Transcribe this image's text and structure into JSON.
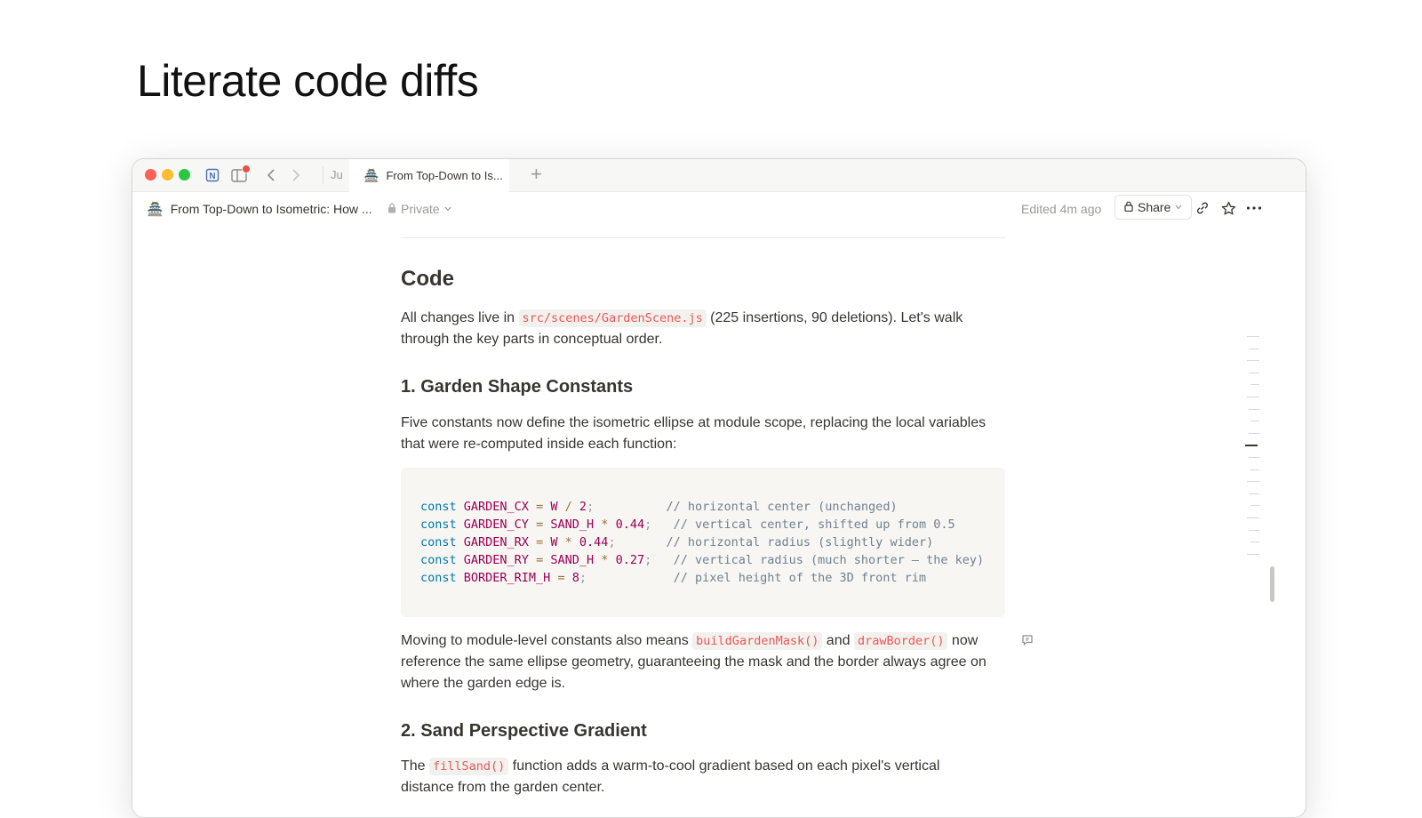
{
  "slide": {
    "title": "Literate code diffs"
  },
  "browser": {
    "tabs": [
      {
        "label": "Ju",
        "active": false
      },
      {
        "label": "From Top-Down to Is...",
        "emoji": "🏯",
        "active": true
      }
    ],
    "new_tab_label": "+",
    "notion_icon": "N"
  },
  "topbar": {
    "page_emoji": "🏯",
    "breadcrumb": "From Top-Down to Isometric: How ...",
    "privacy": "Private",
    "edited": "Edited 4m ago",
    "share_label": "Share",
    "icons": [
      "link-icon",
      "star-icon",
      "more-icon"
    ]
  },
  "doc": {
    "heading": "Code",
    "intro": {
      "before": "All changes live in ",
      "code": "src/scenes/GardenScene.js",
      "after": " (225 insertions, 90 deletions). Let's walk through the key parts in conceptual order."
    },
    "section1": {
      "title": "1. Garden Shape Constants",
      "desc": "Five constants now define the isometric ellipse at module scope, replacing the local variables that were re-computed inside each function:",
      "code_lines": [
        {
          "kw": "const",
          "name": "GARDEN_CX",
          "eq": "=",
          "expr1": "W",
          "op": "/",
          "expr2": "2",
          "semi": ";",
          "pad": "          ",
          "comment": "// horizontal center (unchanged)"
        },
        {
          "kw": "const",
          "name": "GARDEN_CY",
          "eq": "=",
          "expr1": "SAND_H",
          "op": "*",
          "expr2": "0.44",
          "semi": ";",
          "pad": "   ",
          "comment": "// vertical center, shifted up from 0.5"
        },
        {
          "kw": "const",
          "name": "GARDEN_RX",
          "eq": "=",
          "expr1": "W",
          "op": "*",
          "expr2": "0.44",
          "semi": ";",
          "pad": "       ",
          "comment": "// horizontal radius (slightly wider)"
        },
        {
          "kw": "const",
          "name": "GARDEN_RY",
          "eq": "=",
          "expr1": "SAND_H",
          "op": "*",
          "expr2": "0.27",
          "semi": ";",
          "pad": "   ",
          "comment": "// vertical radius (much shorter — the key)"
        },
        {
          "kw": "const",
          "name": "BORDER_RIM_H",
          "eq": "=",
          "expr1": "8",
          "op": "",
          "expr2": "",
          "semi": ";",
          "pad": "            ",
          "comment": "// pixel height of the 3D front rim"
        }
      ],
      "followup": {
        "before": "Moving to module-level constants also means ",
        "code1": "buildGardenMask()",
        "mid": " and ",
        "code2": "drawBorder()",
        "after": " now reference the same ellipse geometry, guaranteeing the mask and the border always agree on where the garden edge is."
      }
    },
    "section2": {
      "title": "2. Sand Perspective Gradient",
      "desc": {
        "before": "The ",
        "code": "fillSand()",
        "after": " function adds a warm-to-cool gradient based on each pixel's vertical distance from the garden center."
      }
    }
  },
  "colors": {
    "accent_code": "#eb5757",
    "keyword": "#0077aa",
    "identifier": "#990055",
    "comment": "#708090"
  }
}
